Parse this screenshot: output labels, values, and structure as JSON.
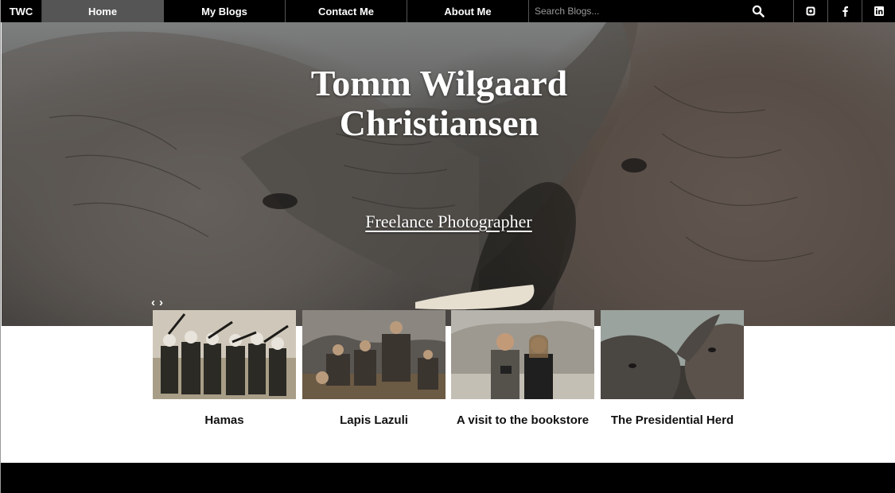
{
  "nav": {
    "brand": "TWC",
    "links": [
      {
        "label": "Home",
        "active": true
      },
      {
        "label": "My Blogs",
        "active": false
      },
      {
        "label": "Contact Me",
        "active": false
      },
      {
        "label": "About Me",
        "active": false
      }
    ],
    "search_placeholder": "Search Blogs...",
    "search_icon": "search-icon",
    "social_icons": [
      "instagram-icon",
      "facebook-icon",
      "linkedin-icon"
    ]
  },
  "hero": {
    "title_line1": "Tomm Wilgaard",
    "title_line2": "Christiansen",
    "subtitle": "Freelance Photographer"
  },
  "carousel": {
    "prev_label": "‹",
    "next_label": "›",
    "cards": [
      {
        "caption": "Hamas"
      },
      {
        "caption": "Lapis Lazuli"
      },
      {
        "caption": "A visit to the bookstore"
      },
      {
        "caption": "The Presidential Herd"
      }
    ]
  },
  "colors": {
    "nav_bg": "#000000",
    "nav_active": "#555555",
    "footer_bg": "#000000"
  }
}
